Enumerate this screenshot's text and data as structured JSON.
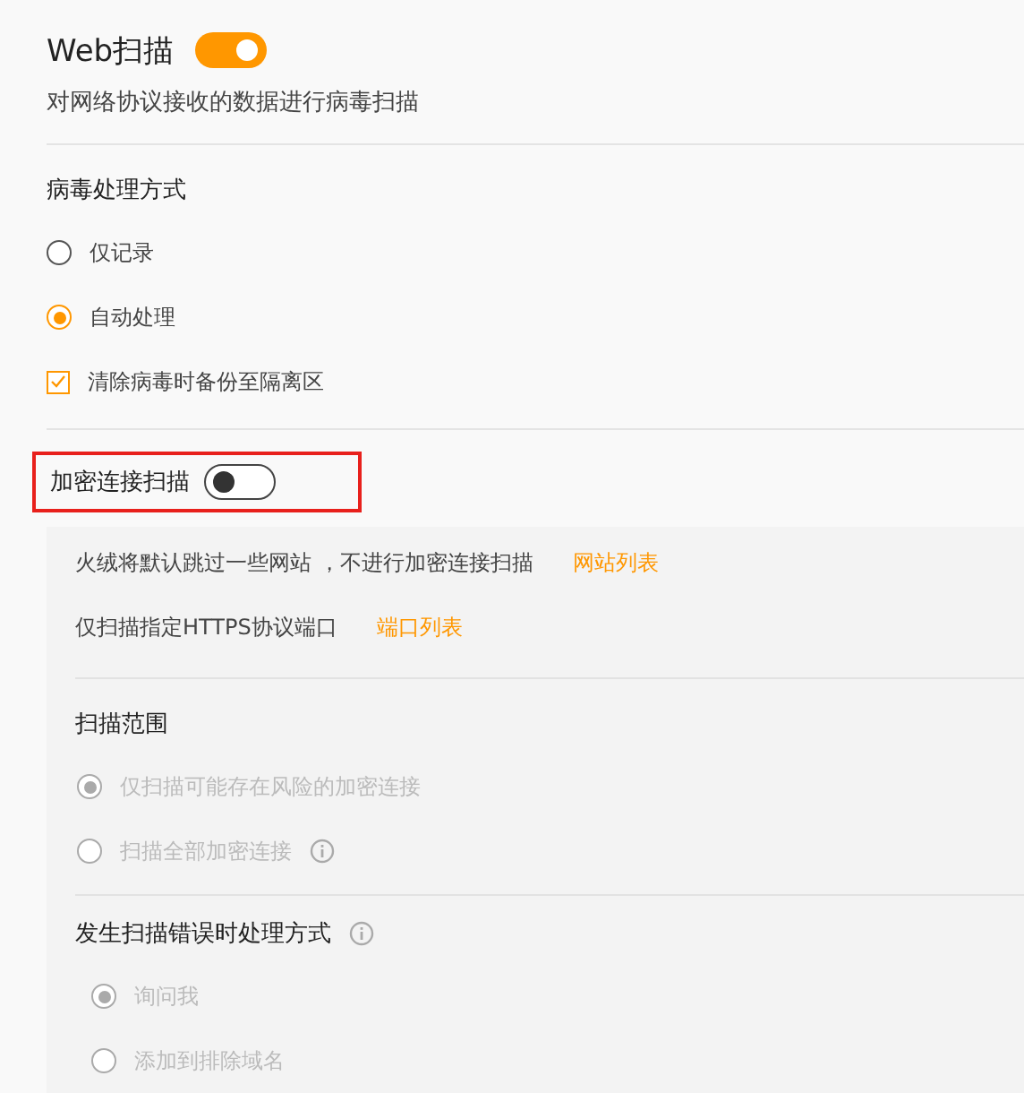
{
  "web_scan": {
    "title": "Web扫描",
    "on": true,
    "description": "对网络协议接收的数据进行病毒扫描"
  },
  "virus_handling": {
    "heading": "病毒处理方式",
    "options": [
      {
        "label": "仅记录",
        "selected": false,
        "disabled": false
      },
      {
        "label": "自动处理",
        "selected": true,
        "disabled": false
      }
    ],
    "backup": {
      "label": "清除病毒时备份至隔离区",
      "checked": true
    }
  },
  "encrypted_scan": {
    "title": "加密连接扫描",
    "on": false,
    "highlighted": true,
    "links": [
      {
        "text": "火绒将默认跳过一些网站 ，不进行加密连接扫描",
        "link": "网站列表"
      },
      {
        "text": "仅扫描指定HTTPS协议端口",
        "link": "端口列表"
      }
    ],
    "scope": {
      "heading": "扫描范围",
      "options": [
        {
          "label": "仅扫描可能存在风险的加密连接",
          "selected": true,
          "disabled": true
        },
        {
          "label": "扫描全部加密连接",
          "selected": false,
          "disabled": true,
          "info": true
        }
      ]
    },
    "error_handling": {
      "heading": "发生扫描错误时处理方式",
      "info": true,
      "options": [
        {
          "label": "询问我",
          "selected": true,
          "disabled": true
        },
        {
          "label": "添加到排除域名",
          "selected": false,
          "disabled": true
        }
      ]
    }
  }
}
